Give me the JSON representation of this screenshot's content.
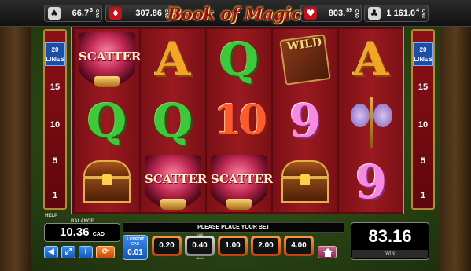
{
  "jackpots": [
    {
      "suit": "spades-icon",
      "glyph": "♠",
      "red": false,
      "amount": "66.7",
      "cents": "3",
      "currency": "CAD"
    },
    {
      "suit": "diamonds-icon",
      "glyph": "♦",
      "red": true,
      "amount": "307.86",
      "cents": "",
      "currency": "CAD"
    },
    {
      "suit": "hearts-icon",
      "glyph": "♥",
      "red": true,
      "amount": "803.",
      "cents": "89",
      "currency": "CAD"
    },
    {
      "suit": "clubs-icon",
      "glyph": "♣",
      "red": false,
      "amount": "1 161.0",
      "cents": "4",
      "currency": "CAD"
    }
  ],
  "logo": "Book of Magic",
  "lines": {
    "header_count": "20",
    "header_word": "LINES",
    "markers": [
      "15",
      "10",
      "5",
      "1"
    ]
  },
  "reels": [
    [
      "scatter",
      "Q",
      "chest"
    ],
    [
      "A",
      "Q",
      "scatter"
    ],
    [
      "Q",
      "10",
      "scatter"
    ],
    [
      "wild",
      "9",
      "chest"
    ],
    [
      "A",
      "wand",
      "9"
    ]
  ],
  "symbol_text": {
    "scatter": "SCATTER",
    "wild": "WILD"
  },
  "bottom": {
    "help_label": "HELP",
    "balance_label": "BALANCE",
    "balance_value": "10.36",
    "balance_currency": "CAD",
    "message": "PLEASE PLACE YOUR BET",
    "credit": {
      "line1": "1 CREDIT",
      "line2": "CAD",
      "value": "0.01"
    },
    "stakes": [
      "0.20",
      "0.40",
      "1.00",
      "2.00",
      "4.00"
    ],
    "selected_stake_index": 1,
    "stake_top_label": "CAD",
    "stake_start_label": "Start",
    "win_value": "83.16",
    "win_label": "WIN"
  },
  "icons": [
    "sound-icon",
    "fullscreen-icon",
    "info-icon",
    "autoplay-icon",
    "home-icon"
  ]
}
